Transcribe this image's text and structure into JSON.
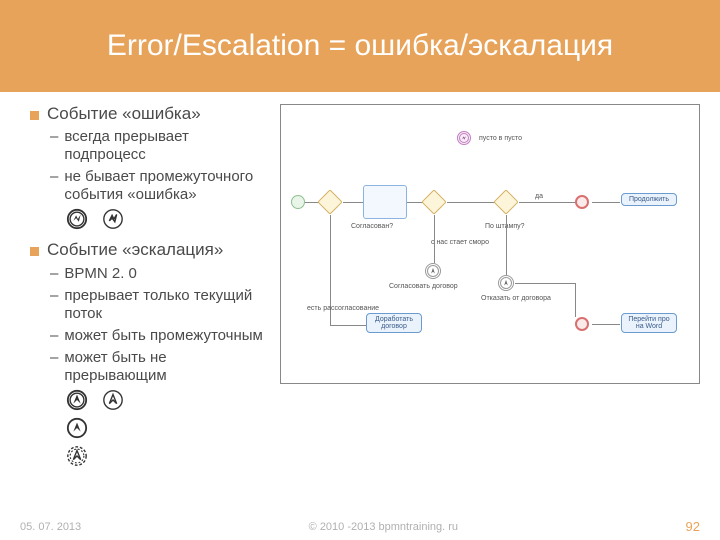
{
  "title": "Error/Escalation = ошибка/эскалация",
  "b1": "Событие «ошибка»",
  "b1s1": "всегда прерывает подпроцесс",
  "b1s2": "не бывает промежуточного события «ошибка»",
  "b2": "Событие «эскалация»",
  "b2s1": "BPMN 2. 0",
  "b2s2": "прерывает только текущий поток",
  "b2s3": "может быть промежуточным",
  "b2s4": "может быть не прерывающим",
  "date": "05. 07. 2013",
  "copyright": "© 2010 -2013 bpmntraining. ru",
  "page": "92",
  "d_soglasovan": "Согласован?",
  "d_poshtampu": "По штампу?",
  "d_da": "да",
  "d_nastaetcmoro": "с нас стает смoро",
  "d_soglasdog": "Согласовать договор",
  "d_dorabotat": "Доработать договор",
  "d_otkazat": "Отказать от договора",
  "d_prodolzhit": "Продолжить",
  "d_pereiti": "Перейти про на Word",
  "d_rassogl": "есть рассогласование",
  "d_pusto": "пусто в пусто"
}
